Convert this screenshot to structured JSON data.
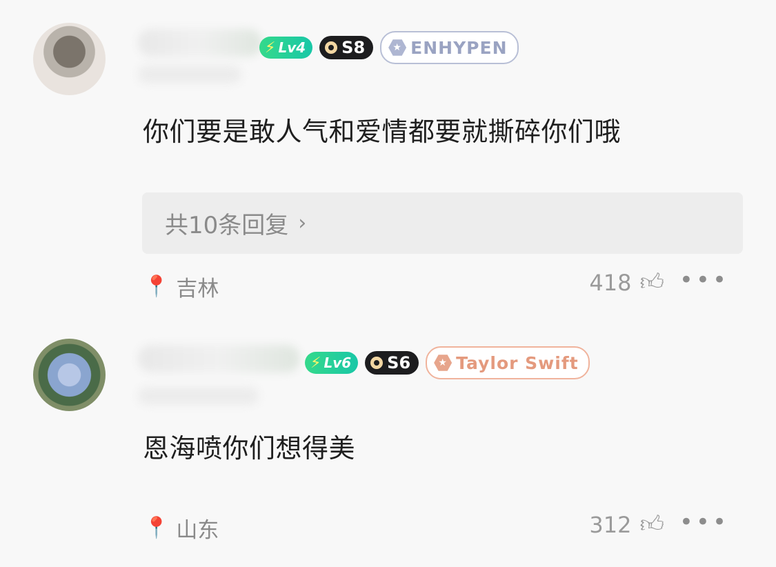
{
  "comments": [
    {
      "level_badge": "Lv4",
      "season_badge": "S8",
      "fan_badge": "ENHYPEN",
      "text": "你们要是敢人气和爱情都要就撕碎你们哦",
      "replies_label": "共10条回复",
      "location": "吉林",
      "likes": "418"
    },
    {
      "level_badge": "Lv6",
      "season_badge": "S6",
      "fan_badge": "Taylor Swift",
      "text": "恩海喷你们想得美",
      "location": "山东",
      "likes": "312"
    }
  ],
  "icons": {
    "location": "map-pin-icon",
    "like": "thumbs-up-icon",
    "more": "more-dots-icon",
    "replies_chevron": "chevron-right-icon"
  }
}
